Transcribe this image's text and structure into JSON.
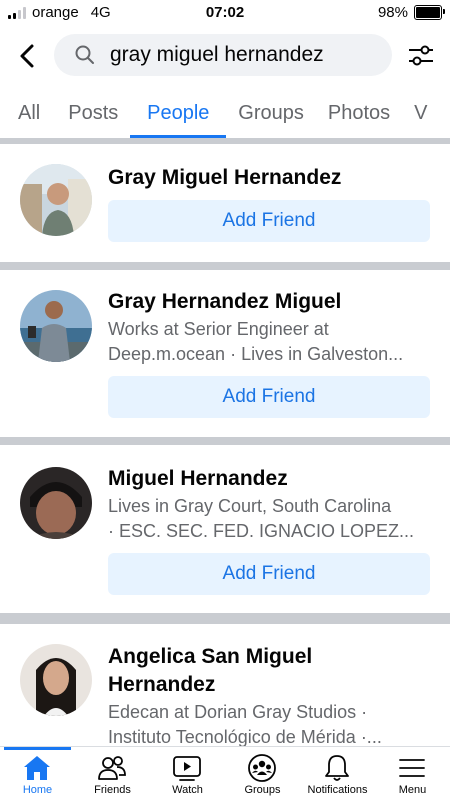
{
  "status_bar": {
    "carrier": "orange",
    "network": "4G",
    "time": "07:02",
    "battery": "98%",
    "battery_level": 0.98
  },
  "search": {
    "query": "gray miguel hernandez"
  },
  "tabs": [
    {
      "label": "All",
      "active": false
    },
    {
      "label": "Posts",
      "active": false
    },
    {
      "label": "People",
      "active": true
    },
    {
      "label": "Groups",
      "active": false
    },
    {
      "label": "Photos",
      "active": false
    },
    {
      "label": "V",
      "active": false
    }
  ],
  "results": [
    {
      "name": "Gray Miguel Hernandez",
      "subtitle_lines": [],
      "button": "Add Friend"
    },
    {
      "name": "Gray Hernandez Miguel",
      "subtitle_lines": [
        "Works at Serior Engineer at",
        "Deep.m.ocean · Lives in Galveston..."
      ],
      "button": "Add Friend"
    },
    {
      "name": "Miguel Hernandez",
      "subtitle_lines": [
        "Lives in Gray Court, South Carolina",
        "· ESC. SEC. FED. IGNACIO LOPEZ..."
      ],
      "button": "Add Friend"
    },
    {
      "name_lines": [
        "Angelica San Miguel",
        "Hernandez"
      ],
      "subtitle_lines": [
        "Edecan at Dorian Gray Studios ·",
        "Instituto Tecnológico de Mérida ·..."
      ]
    }
  ],
  "bottom_nav": [
    {
      "label": "Home",
      "icon": "home-icon",
      "active": true
    },
    {
      "label": "Friends",
      "icon": "friends-icon",
      "active": false
    },
    {
      "label": "Watch",
      "icon": "watch-icon",
      "active": false
    },
    {
      "label": "Groups",
      "icon": "groups-icon",
      "active": false
    },
    {
      "label": "Notifications",
      "icon": "bell-icon",
      "active": false
    },
    {
      "label": "Menu",
      "icon": "menu-icon",
      "active": false
    }
  ],
  "colors": {
    "accent": "#1877f2",
    "button_bg": "#e7f3ff",
    "secondary_text": "#65676b",
    "divider": "#c9ccd1"
  }
}
